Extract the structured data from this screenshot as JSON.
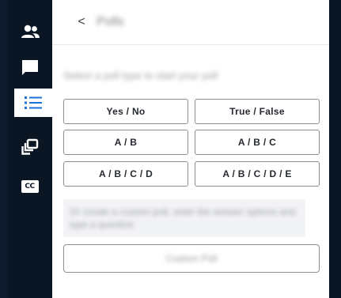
{
  "sidebar": {
    "items": [
      {
        "icon": "users-icon"
      },
      {
        "icon": "chat-icon"
      },
      {
        "icon": "list-icon",
        "active": true
      },
      {
        "icon": "layers-icon"
      },
      {
        "icon": "closed-captions-icon",
        "text": "CC"
      }
    ]
  },
  "header": {
    "back_glyph": "<",
    "title": "Polls"
  },
  "prompt": "Select a poll type to start your poll",
  "options": [
    {
      "label": "Yes / No"
    },
    {
      "label": "True / False"
    },
    {
      "label": "A / B"
    },
    {
      "label": "A / B / C"
    },
    {
      "label": "A / B / C / D"
    },
    {
      "label": "A / B / C / D / E"
    }
  ],
  "description": "Or create a custom poll, enter the answer options and type a question",
  "custom_button": "Custom Poll",
  "colors": {
    "sidebar_bg": "#0b1625",
    "active_icon": "#1b6fd9",
    "icon": "#ffffff"
  }
}
